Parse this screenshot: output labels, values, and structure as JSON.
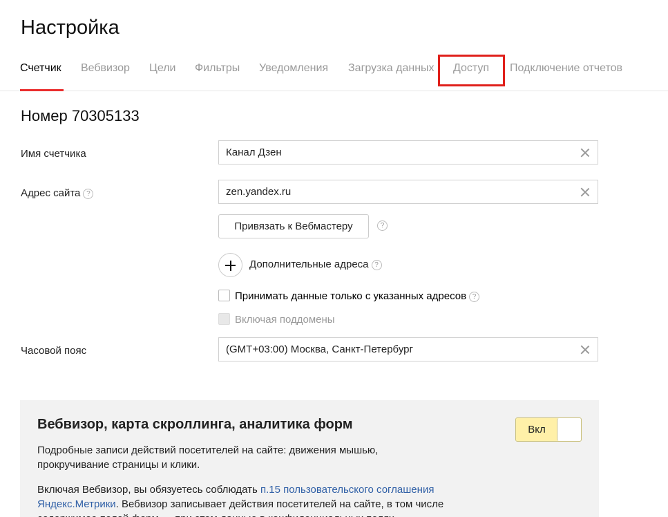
{
  "page": {
    "title": "Настройка"
  },
  "tabs": [
    {
      "label": "Счетчик",
      "active": true
    },
    {
      "label": "Вебвизор",
      "active": false
    },
    {
      "label": "Цели",
      "active": false
    },
    {
      "label": "Фильтры",
      "active": false
    },
    {
      "label": "Уведомления",
      "active": false
    },
    {
      "label": "Загрузка данных",
      "active": false
    },
    {
      "label": "Доступ",
      "active": false,
      "highlighted": true
    },
    {
      "label": "Подключение отчетов",
      "active": false
    }
  ],
  "counter": {
    "number_label": "Номер 70305133"
  },
  "fields": {
    "name": {
      "label": "Имя счетчика",
      "value": "Канал Дзен"
    },
    "site": {
      "label": "Адрес сайта",
      "value": "zen.yandex.ru"
    },
    "timezone": {
      "label": "Часовой пояс",
      "value": "(GMT+03:00) Москва, Санкт-Петербург"
    }
  },
  "buttons": {
    "webmaster": "Привязать к Вебмастеру"
  },
  "extra_addresses": {
    "label": "Дополнительные адреса"
  },
  "checkboxes": {
    "only_specified": {
      "label": "Принимать данные только с указанных адресов",
      "checked": false
    },
    "subdomains": {
      "label": "Включая поддомены",
      "checked": false,
      "disabled": true
    }
  },
  "help_glyph": "?",
  "webvisor": {
    "title": "Вебвизор, карта скроллинга, аналитика форм",
    "toggle_label": "Вкл",
    "toggle_on": true,
    "desc_line1": "Подробные записи действий посетителей на сайте: движения мышью,",
    "desc_line2": "прокручивание страницы и клики.",
    "agree_prefix": "Включая Вебвизор, вы обязуетесь соблюдать ",
    "agree_link_1": "п.15 пользовательского соглашения",
    "agree_link_2": "Яндекс.Метрики",
    "agree_suffix": ". Вебвизор записывает действия посетителей на сайте, в том числе",
    "agree_cut": "содержимое полей форм — при этом данные в конфиденциальных полях"
  },
  "colors": {
    "accent_red": "#ea2d2d",
    "highlight_red": "#e0201b",
    "link": "#2f5fa6",
    "toggle_yellow": "#fff0a8",
    "panel_bg": "#f2f2f2"
  }
}
